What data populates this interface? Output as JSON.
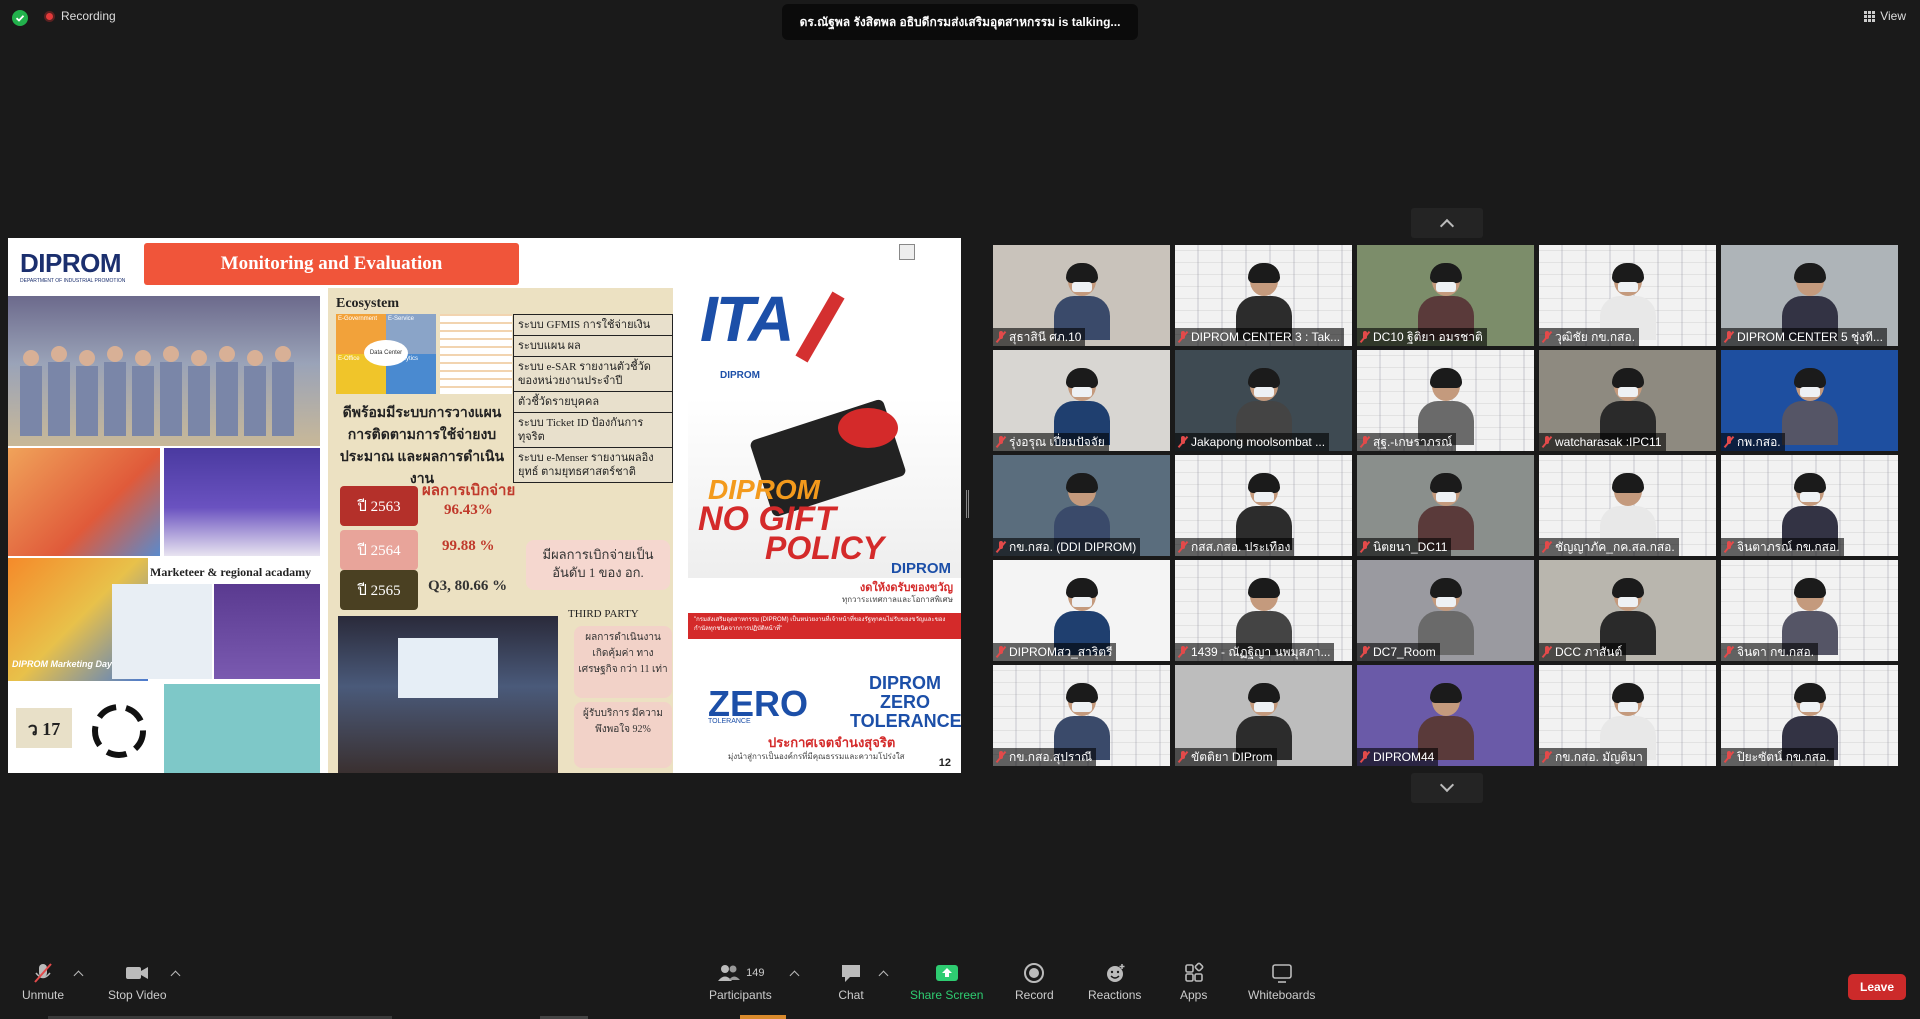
{
  "topbar": {
    "recording_label": "Recording",
    "speaker_text": "ดร.ณัฐพล รังสิตพล อธิบดีกรมส่งเสริมอุตสาหกรรม is talking...",
    "view_label": "View"
  },
  "slide": {
    "logo": "DIPROM",
    "logo_sub": "DEPARTMENT OF INDUSTRIAL PROMOTION",
    "banner": "Monitoring and Evaluation",
    "ecosystem_title": "Ecosystem",
    "eco_items": [
      "E-Government",
      "E-Service",
      "Data Center",
      "E-Office",
      "E-Analytics"
    ],
    "heading": "ดีพร้อมมีระบบการวางแผน การติดตามการใช้จ่ายงบประมาณ และผลการดำเนินงาน",
    "disbursement_label": "ผลการเบิกจ่าย",
    "years": [
      {
        "label": "ปี 2563",
        "value": "96.43%",
        "color": "#b4302a"
      },
      {
        "label": "ปี 2564",
        "value": "99.88 %",
        "color": "#e8a49a"
      },
      {
        "label": "ปี 2565",
        "value": "Q3, 80.66 %",
        "color": "#4a4022"
      }
    ],
    "systems": [
      "ระบบ GFMIS การใช้จ่ายเงิน",
      "ระบบแผน ผล",
      "ระบบ e-SAR รายงานตัวชี้วัดของหน่วยงานประจำปี",
      "ตัวชี้วัดรายบุคคล",
      "ระบบ Ticket ID ป้องกันการทุจริต",
      "ระบบ e-Menser รายงานผลอิงยุทธ์ ตามยุทธศาสตร์ชาติ"
    ],
    "pink_box": "มีผลการเบิกจ่ายเป็นอันดับ 1 ของ อก.",
    "marketeer": "Marketeer & regional acadamy",
    "marketing_day": "DIPROM Marketing Day",
    "third_party": "THIRD PARTY",
    "third_box1": "ผลการดำเนินงาน เกิดคุ้มค่า ทางเศรษฐกิจ กว่า 11 เท่า",
    "third_box2": "ผู้รับบริการ มีความพึงพอใจ 92%",
    "v17": "ว 17",
    "ita": "ITA",
    "diprom_small": "DIPROM",
    "nogift1": "DIPROM",
    "nogift2": "NO GIFT",
    "nogift3": "POLICY",
    "diprom_r": "DIPROM",
    "thai_red": "งดให้งดรับของขวัญ",
    "thai_sm": "ทุกวาระเทศกาลและโอกาสพิเศษ",
    "red_strip": "\"กรมส่งเสริมอุตสาหกรรม (DIPROM) เป็นหน่วยงานที่เจ้าหน้าที่ของรัฐทุกคนไม่รับของขวัญและของกำนัลทุกชนิดจากการปฏิบัติหน้าที่\"",
    "zero": "ZERO",
    "zero_tol": "TOLERANCE",
    "dz": "DIPROM ZERO TOLERANCE",
    "thai_zero": "ประกาศเจตจำนงสุจริต",
    "thai_zero2": "มุ่งนำสู่การเป็นองค์กรที่มีคุณธรรมและความโปร่งใส",
    "page_number": "12"
  },
  "participants": [
    {
      "name": "สุธาสินี ศภ.10",
      "bg": "#c9c3bb"
    },
    {
      "name": "DIPROM CENTER 3 : Tak...",
      "bg": "wall"
    },
    {
      "name": "DC10 ฐิติยา อมรชาติ",
      "bg": "#7c8d6a"
    },
    {
      "name": "วุฒิชัย กข.กสอ.",
      "bg": "wall"
    },
    {
      "name": "DIPROM CENTER 5 ชุ่งที...",
      "bg": "#aeb4b8"
    },
    {
      "name": "รุ่งอรุณ เปี่ยมปัจจัย",
      "bg": "#d8d6d2"
    },
    {
      "name": "Jakapong moolsombat ...",
      "bg": "#3e4a52"
    },
    {
      "name": "สุฐ.-เกษราภรณ์",
      "bg": "wall"
    },
    {
      "name": "watcharasak :IPC11",
      "bg": "#8e8a80"
    },
    {
      "name": "กพ.กสอ.",
      "bg": "#1e4fa0"
    },
    {
      "name": "กข.กสอ. (DDI DIPROM)",
      "bg": "#5a6d7d"
    },
    {
      "name": "กสส.กสอ. ประเทือง",
      "bg": "wall"
    },
    {
      "name": "นิตยนา_DC11",
      "bg": "#8a8f8c"
    },
    {
      "name": "ชัญญาภัค_กค.สล.กสอ.",
      "bg": "wall"
    },
    {
      "name": "จินตาภรณ์ กข.กสอ.",
      "bg": "wall"
    },
    {
      "name": "DIPROMสว_สาริตรี",
      "bg": "#f4f4f4"
    },
    {
      "name": "1439 - ณัฏฐิญา นพมุสภา...",
      "bg": "wall"
    },
    {
      "name": "DC7_Room",
      "bg": "#9a9aa0"
    },
    {
      "name": "DCC ภาสันต์",
      "bg": "#b9b6ae"
    },
    {
      "name": "จินดา กข.กสอ.",
      "bg": "wall"
    },
    {
      "name": "กข.กสอ.สุปราณี",
      "bg": "wall"
    },
    {
      "name": "ขัตติยา DIProm",
      "bg": "#bdbdbd"
    },
    {
      "name": "DIPROM44",
      "bg": "#6a5aa8"
    },
    {
      "name": "กข.กสอ. มัญติมา",
      "bg": "wall"
    },
    {
      "name": "ปิยะซัตน์ กข.กสอ.",
      "bg": "wall"
    }
  ],
  "toolbar": {
    "unmute": "Unmute",
    "stop_video": "Stop Video",
    "participants_count": "149",
    "participants": "Participants",
    "chat": "Chat",
    "share_screen": "Share Screen",
    "record": "Record",
    "reactions": "Reactions",
    "apps": "Apps",
    "whiteboards": "Whiteboards",
    "leave": "Leave"
  },
  "colors": {
    "accent_green": "#2ecc71",
    "leave_red": "#cc2a2a",
    "mute_red": "#e24a4a"
  }
}
